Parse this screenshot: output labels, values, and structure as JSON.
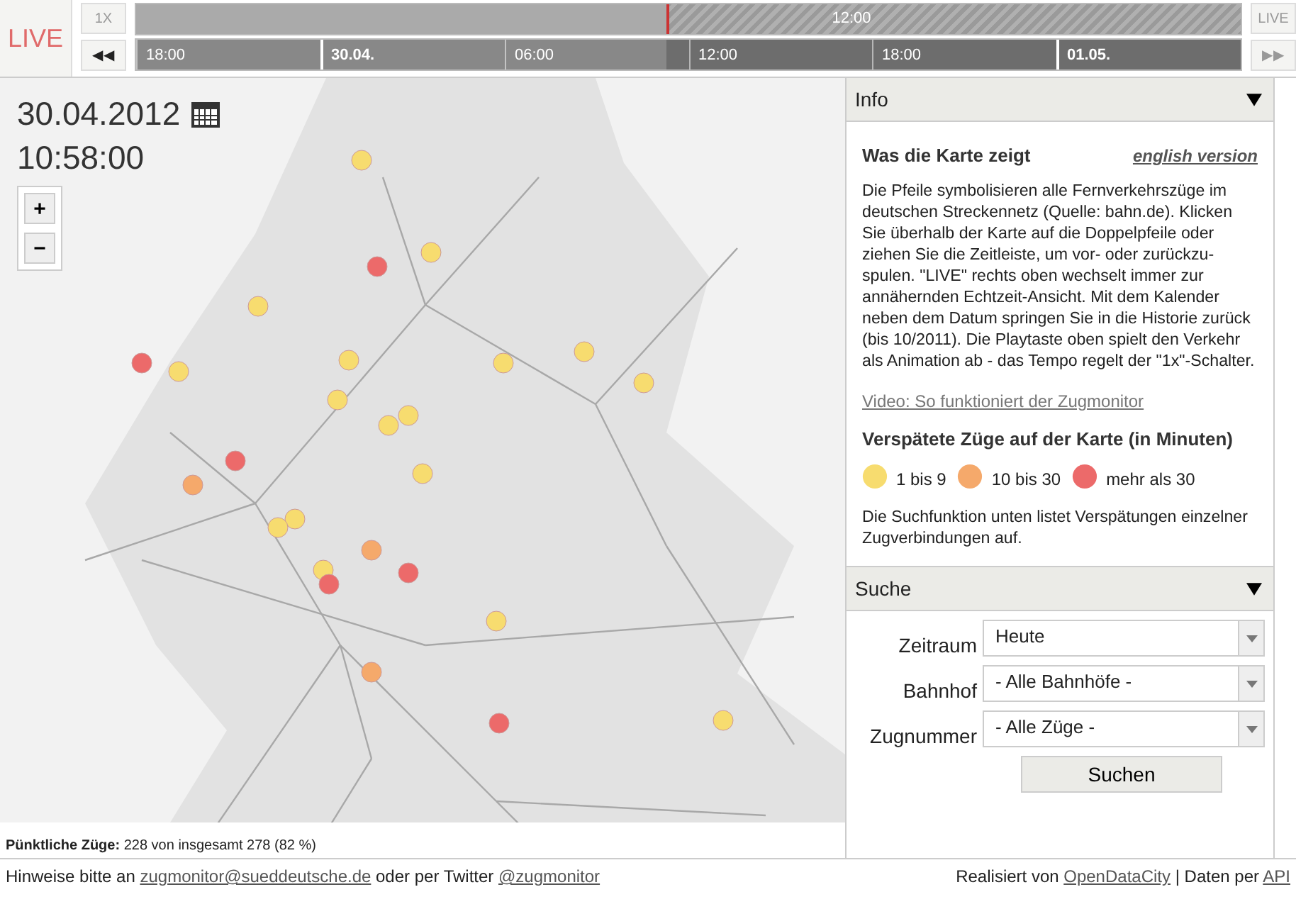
{
  "header": {
    "live_label": "LIVE",
    "speed_button": "1X",
    "rewind_button": "◀◀",
    "live_button": "LIVE",
    "forward_button": "▶▶"
  },
  "timeline": {
    "upper_labels": [
      "12:00"
    ],
    "lower_labels": [
      {
        "kind": "hour",
        "text": "18:00"
      },
      {
        "kind": "day",
        "text": "30.04."
      },
      {
        "kind": "hour",
        "text": "06:00"
      },
      {
        "kind": "hour",
        "text": "12:00"
      },
      {
        "kind": "hour",
        "text": "18:00"
      },
      {
        "kind": "day",
        "text": "01.05."
      }
    ],
    "level": 0.48
  },
  "map": {
    "date": "30.04.2012",
    "time": "10:58:00",
    "zoom_in": "+",
    "zoom_out": "−",
    "status": "**Pünktliche Züge:** 228 von insgesamt 278 (82 %)"
  },
  "info": {
    "title": "Info",
    "expanded": true,
    "heading": "Was die Karte zeigt",
    "english_link": "english version",
    "text": "Die Pfeile symbolisieren alle Fernverkehrszüge im deutschen Streckennetz (Quelle: bahn.de). Klicken Sie überhalb der Karte auf die Doppelpfeile oder ziehen Sie die Zeitleiste, um vor- oder zurückzu-spulen. \"LIVE\" rechts oben wechselt immer zur annähernden Echtzeit-Ansicht. Mit dem Kalender neben dem Datum springen Sie in die Historie zurück (bis 10/2011). Die Playtaste oben spielt den Verkehr als Animation ab - das Tempo regelt der \"1x\"-Schalter.",
    "video_link": "Video: So funktioniert der Zugmonitor",
    "legend_title": "Verspätete Züge auf der Karte (in Minuten)",
    "legend": [
      {
        "label": "1 bis 9",
        "color": "#f7dc6f"
      },
      {
        "label": "10 bis 30",
        "color": "#f5a96b"
      },
      {
        "label": "mehr als 30",
        "color": "#ec6a6a"
      }
    ],
    "note": "Die Suchfunktion unten listet Verspätungen einzelner Zugverbindungen auf."
  },
  "search": {
    "title": "Suche",
    "expanded": true,
    "fields": [
      {
        "label": "Zeitraum",
        "value": "Heute"
      },
      {
        "label": "Bahnhof",
        "value": "- Alle Bahnhöfe -"
      },
      {
        "label": "Zugnummer",
        "value": "- Alle Züge -"
      }
    ],
    "button": "Suchen"
  },
  "footer": {
    "left": [
      {
        "kind": "text",
        "text": "Hinweise bitte an "
      },
      {
        "kind": "link",
        "text": "zugmonitor@sueddeutsche.de"
      },
      {
        "kind": "text",
        "text": " oder per Twitter "
      },
      {
        "kind": "link",
        "text": "@zugmonitor"
      }
    ],
    "right": [
      {
        "kind": "text",
        "text": "Realisiert von "
      },
      {
        "kind": "link",
        "text": "OpenDataCity"
      },
      {
        "kind": "text",
        "text": " | Daten per "
      },
      {
        "kind": "link",
        "text": "API"
      }
    ]
  }
}
